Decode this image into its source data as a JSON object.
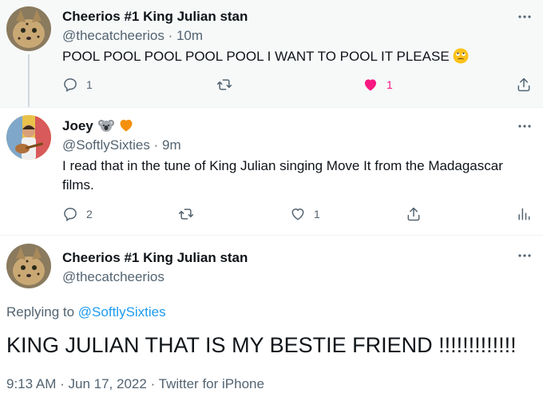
{
  "tweets": [
    {
      "name": "Cheerios #1 King Julian stan",
      "handle": "@thecatcheerios",
      "sep": "·",
      "time": "10m",
      "text": "POOL POOL POOL POOL POOL I WANT TO POOL IT PLEASE",
      "text_emoji": "rolling-eyes-emoji",
      "replies": "1",
      "retweets": "",
      "likes": "1",
      "liked": true
    },
    {
      "name": "Joey",
      "name_emojis": [
        "koala-emoji",
        "orange-heart-emoji"
      ],
      "handle": "@SoftlySixties",
      "sep": "·",
      "time": "9m",
      "text": "I read that in the tune of King Julian singing Move It from the Madagascar films.",
      "replies": "2",
      "retweets": "",
      "likes": "1",
      "liked": false
    }
  ],
  "main": {
    "name": "Cheerios #1 King Julian stan",
    "handle": "@thecatcheerios",
    "replying_label": "Replying to",
    "replying_handle": "@SoftlySixties",
    "text": "KING JULIAN THAT IS MY BESTIE FRIEND !!!!!!!!!!!!!",
    "time": "9:13 AM",
    "sep1": "·",
    "date": "Jun 17, 2022",
    "sep2": "·",
    "source": "Twitter for iPhone"
  },
  "colors": {
    "accent": "#1d9bf0",
    "like": "#f91880",
    "secondary": "#536471"
  }
}
